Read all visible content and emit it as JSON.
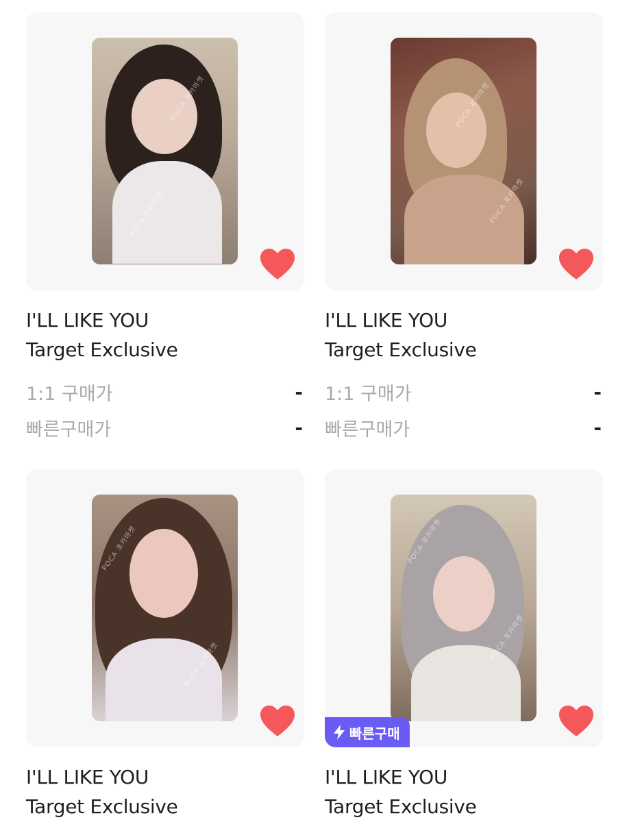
{
  "colors": {
    "heart": "#f5585b",
    "badge_bg": "#6b5bf5",
    "card_bg": "#f7f7f8",
    "muted_text": "#a9a9ad"
  },
  "products": [
    {
      "title_line1": "I'LL LIKE YOU",
      "title_line2": "Target Exclusive",
      "price_label_1": "1:1 구매가",
      "price_value_1": "-",
      "price_label_2": "빠른구매가",
      "price_value_2": "-",
      "liked": true,
      "watermark": "POCA 포카마켓"
    },
    {
      "title_line1": "I'LL LIKE YOU",
      "title_line2": "Target Exclusive",
      "price_label_1": "1:1 구매가",
      "price_value_1": "-",
      "price_label_2": "빠른구매가",
      "price_value_2": "-",
      "liked": true,
      "watermark": "POCA 포카마켓"
    },
    {
      "title_line1": "I'LL LIKE YOU",
      "title_line2": "Target Exclusive",
      "liked": true,
      "watermark": "POCA 포카마켓"
    },
    {
      "title_line1": "I'LL LIKE YOU",
      "title_line2": "Target Exclusive",
      "liked": true,
      "badge": "빠른구매",
      "badge_icon": "lightning-icon",
      "watermark": "POCA 포카마켓"
    }
  ]
}
